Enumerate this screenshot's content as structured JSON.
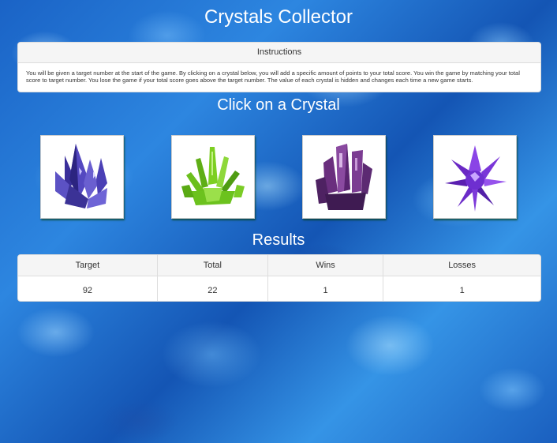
{
  "title": "Crystals Collector",
  "instructions": {
    "heading": "Instructions",
    "body": "You will be given a target number at the start of the game. By clicking on a crystal below, you will add a specific amount of points to your total score. You win the game by matching your total score to target number. You lose the game if your total score goes above the target number. The value of each crystal is hidden and changes each time a new game starts."
  },
  "crystals_heading": "Click on a Crystal",
  "crystals": [
    {
      "name": "blue-crystal",
      "color": "#4b3fae"
    },
    {
      "name": "green-crystal",
      "color": "#6fc21c"
    },
    {
      "name": "purple-crystal",
      "color": "#7a3f8f"
    },
    {
      "name": "violet-crystal",
      "color": "#7b2fd6"
    }
  ],
  "results": {
    "heading": "Results",
    "columns": [
      "Target",
      "Total",
      "Wins",
      "Losses"
    ],
    "values": [
      "92",
      "22",
      "1",
      "1"
    ]
  }
}
